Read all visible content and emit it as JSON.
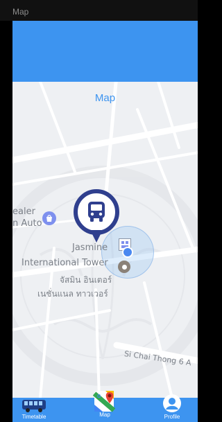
{
  "status_bar": {
    "title": "Map"
  },
  "map": {
    "title": "Map",
    "labels": {
      "dealer_line1": "ealer",
      "dealer_line2": "n Auto",
      "tower_line1": "Jasmine",
      "tower_line2": "International Tower",
      "tower_thai_line1": "จัสมิน อินเตอร์",
      "tower_thai_line2": "เนชั่นแนล ทาวเวอร์",
      "street": "Si Chai Thong 6 A"
    }
  },
  "bottom_nav": {
    "items": [
      {
        "label": "Timetable",
        "icon": "bus-icon"
      },
      {
        "label": "Map",
        "icon": "map-icon"
      },
      {
        "label": "Profile",
        "icon": "profile-icon"
      }
    ]
  },
  "colors": {
    "primary": "#3d94f0",
    "pin": "#2f3f8e",
    "map_background": "#eef0f3"
  }
}
